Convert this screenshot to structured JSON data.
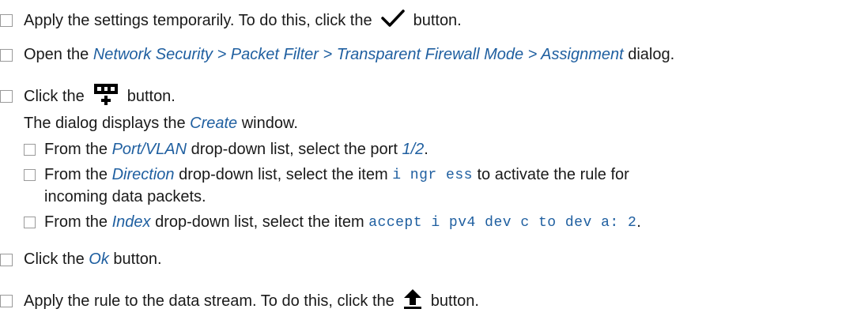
{
  "steps": {
    "s1": {
      "text_a": "Apply the settings temporarily. To do this, click the",
      "text_b": "button.",
      "icon": "checkmark-icon"
    },
    "s2": {
      "text_a": "Open the",
      "path": "Network Security > Packet Filter > Transparent Firewall Mode > Assignment",
      "text_b": "dialog."
    },
    "s3": {
      "text_a": "Click the",
      "text_b": "button.",
      "icon": "add-table-row-icon",
      "result_a": "The dialog displays the",
      "result_window": "Create",
      "result_b": "window.",
      "sub1": {
        "text_a": "From the",
        "field": "Port/VLAN",
        "text_b": "drop-down list, select the port",
        "value": "1/2",
        "end": "."
      },
      "sub2": {
        "text_a": "From the",
        "field": "Direction",
        "text_b": "drop-down list, select the item",
        "value": "i ngr ess",
        "text_c": "to activate the rule for",
        "text_d": "incoming data packets."
      },
      "sub3": {
        "text_a": "From the",
        "field": "Index",
        "text_b": "drop-down list, select the item",
        "value": "accept i pv4 dev c to dev a: 2",
        "end": "."
      }
    },
    "s4": {
      "text_a": "Click the",
      "button": "Ok",
      "text_b": "button."
    },
    "s5": {
      "text_a": "Apply the rule to the data stream. To do this, click the",
      "text_b": "button.",
      "icon": "upload-arrow-icon"
    }
  },
  "colors": {
    "text": "#1a1a1a",
    "gui_element": "#1f5fa0",
    "checkbox_border": "#9a9a9a",
    "icon": "#000000"
  }
}
